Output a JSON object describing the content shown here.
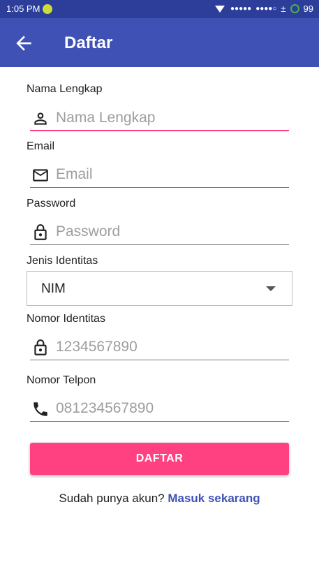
{
  "status_bar": {
    "time": "1:05 PM",
    "battery": "99",
    "signal_1": "●●●●●",
    "signal_2": "●●●●○",
    "data_indicator": "±"
  },
  "app_bar": {
    "title": "Daftar",
    "back_icon": "arrow-back-icon"
  },
  "form": {
    "full_name": {
      "label": "Nama Lengkap",
      "placeholder": "Nama Lengkap",
      "value": "",
      "icon": "person-icon"
    },
    "email": {
      "label": "Email",
      "placeholder": "Email",
      "value": "",
      "icon": "mail-icon"
    },
    "password": {
      "label": "Password",
      "placeholder": "Password",
      "value": "",
      "icon": "lock-icon"
    },
    "identity_type": {
      "label": "Jenis Identitas",
      "selected": "NIM"
    },
    "identity_number": {
      "label": "Nomor Identitas",
      "placeholder": "1234567890",
      "value": "",
      "icon": "lock-icon"
    },
    "phone": {
      "label": "Nomor Telpon",
      "placeholder": "081234567890",
      "value": "",
      "icon": "phone-icon"
    },
    "submit_label": "DAFTAR"
  },
  "footer": {
    "prompt": "Sudah punya akun? ",
    "link": "Masuk sekarang"
  },
  "colors": {
    "status_bar": "#2d3e9a",
    "primary": "#3f51b5",
    "accent": "#ff4081"
  }
}
